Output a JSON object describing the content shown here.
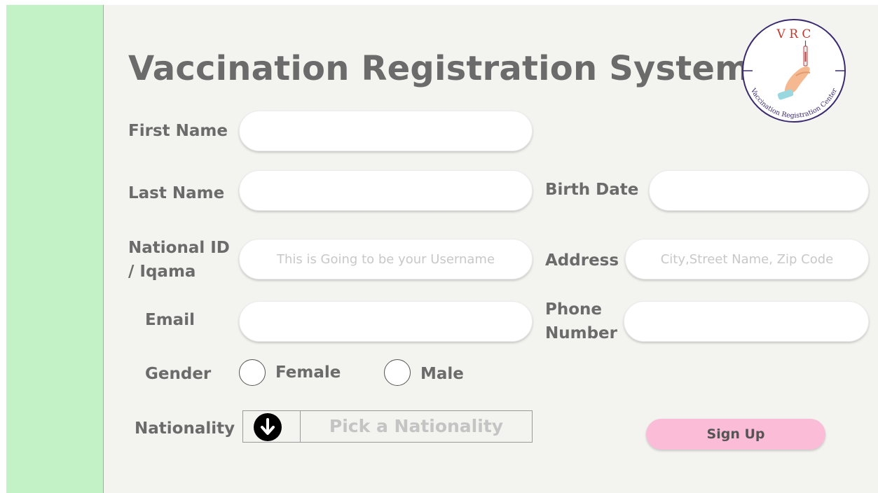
{
  "app": {
    "title": "Vaccination Registration System"
  },
  "logo": {
    "initials": "V R C",
    "ring_text": "Vaccination Registration Center",
    "icon": "hand-syringe-icon"
  },
  "form": {
    "first_name": {
      "label": "First Name",
      "value": "",
      "placeholder": ""
    },
    "last_name": {
      "label": "Last Name",
      "value": "",
      "placeholder": ""
    },
    "birth_date": {
      "label": "Birth Date",
      "value": "",
      "placeholder": ""
    },
    "national_id": {
      "label_line1": "National ID",
      "label_line2": "/ Iqama",
      "value": "",
      "placeholder": "This is Going to be your Username"
    },
    "address": {
      "label": "Address",
      "value": "",
      "placeholder": "City,Street Name, Zip Code"
    },
    "email": {
      "label": "Email",
      "value": "",
      "placeholder": ""
    },
    "phone": {
      "label_line1": "Phone",
      "label_line2": "Number",
      "value": "",
      "placeholder": ""
    },
    "gender": {
      "label": "Gender",
      "options": [
        "Female",
        "Male"
      ],
      "selected": null
    },
    "nationality": {
      "label": "Nationality",
      "placeholder": "Pick a Nationality",
      "icon": "arrow-down-circle-icon"
    },
    "submit_label": "Sign Up"
  },
  "colors": {
    "sidebar": "#c2f2c6",
    "background": "#f3f3ef",
    "button": "#fbbcd8",
    "text": "#6b6b6b",
    "logo": "#3b2a6e"
  }
}
